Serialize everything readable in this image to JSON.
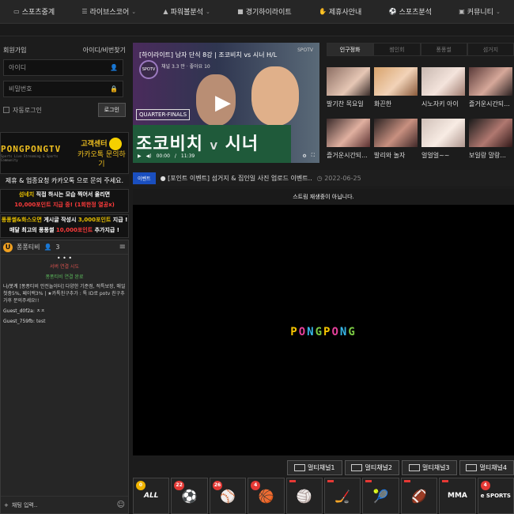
{
  "nav": [
    {
      "label": "스포츠중계",
      "icon": "tv-icon",
      "caret": false
    },
    {
      "label": "라이브스코어",
      "icon": "list-icon",
      "caret": true
    },
    {
      "label": "파워볼분석",
      "icon": "chart-icon",
      "caret": true
    },
    {
      "label": "경기하이라이트",
      "icon": "video-icon",
      "caret": false
    },
    {
      "label": "제휴사안내",
      "icon": "handshake-icon",
      "caret": false
    },
    {
      "label": "스포츠분석",
      "icon": "soccer-icon",
      "caret": false
    },
    {
      "label": "커뮤니티",
      "icon": "chat-icon",
      "caret": true
    }
  ],
  "login": {
    "join": "회원가입",
    "find": "아이디/비번찾기",
    "id_placeholder": "아이디",
    "pw_placeholder": "비밀번호",
    "auto": "자동로그인",
    "button": "로그인"
  },
  "banner": {
    "brand": "PONGPONGTV",
    "brand_sub": "Sports Live Streaming & Sports Community",
    "cs1": "고객센터",
    "cs2": "카카오톡 문의하기"
  },
  "notices": {
    "line1": "제휴 & 업종요청 카카오톡 으로 문의 주세요.",
    "n2_a": "섬네치",
    "n2_b": " 직접 하시는 모습 찍어서 올리면",
    "n2_c": "10,000포인트 지급 중! (1회한정 열공x)",
    "n3_a": "퐁퐁썰&화스오면",
    "n3_b": " 게시글 작성시 ",
    "n3_c": "3,000포인트",
    "n3_d": " 지급 !",
    "n3_e": "매달 최고의 퐁퐁썰 ",
    "n3_f": "10,000포인트",
    "n3_g": " 추가지급 !"
  },
  "chat": {
    "room": "퐁퐁티비",
    "users": "3",
    "sys1": "서버 연결 시도",
    "sys2": "퐁퐁티비 연결 완료",
    "messages": [
      {
        "name": "나/봇계",
        "text": "[퐁퐁티비 안전놀이터] 다양한 기준점, 적특보장, 매일첫충5%, 페이백3% | ★카톡친구추가 : 톡 ID로 potv 친구추가후 문의주세요!!"
      },
      {
        "name": "Guest_d0f2a:",
        "text": "ㅈㅈ"
      },
      {
        "name": "Guest_759fb:",
        "text": "test"
      }
    ],
    "input_placeholder": "채팅 입력.."
  },
  "hero": {
    "title": "[하이라이트] 남자 단식 8강 | 조코비치 vs 시너 H/L",
    "meta": "채널 3.3 만 · 좋아요 10",
    "badge": "SPOTV",
    "corner": "SPOTV",
    "stage": "QUARTER-FINALS",
    "big_left": "조코비치",
    "big_v": "V",
    "big_right": "시너",
    "time_now": "00:00",
    "time_total": "11:39"
  },
  "tabs": [
    "인구정화",
    "썸인회",
    "퐁퐁썰",
    "섬거지"
  ],
  "thumbs": [
    {
      "caption": "발기찬 목요일"
    },
    {
      "caption": "화끈한"
    },
    {
      "caption": "시노자키 아이"
    },
    {
      "caption": "즐거운시간되..."
    },
    {
      "caption": "즐거운시간되..."
    },
    {
      "caption": "발리와 놀자"
    },
    {
      "caption": "얼얼얼~~"
    },
    {
      "caption": "보일랑 말랑..."
    }
  ],
  "ticker": {
    "tag": "이벤트",
    "text": "● [포인트 이벤트] 섬거지 & 집인일 사진 업로드 이벤트..",
    "date": "2022-06-25"
  },
  "player": {
    "message": "스트림 재생중이 아닙니다.",
    "logo": [
      "P",
      "O",
      "N",
      "G",
      "P",
      "O",
      "N",
      "G"
    ]
  },
  "multi": [
    "멀티채널1",
    "멀티채널2",
    "멀티채널3",
    "멀티채널4"
  ],
  "sports": [
    {
      "name": "all-icon",
      "glyph": "ALL",
      "badge": "0",
      "gold": true
    },
    {
      "name": "soccer-icon",
      "glyph": "⚽",
      "badge": "22",
      "gold": false
    },
    {
      "name": "baseball-icon",
      "glyph": "⚾",
      "badge": "26",
      "gold": false
    },
    {
      "name": "basketball-icon",
      "glyph": "🏀",
      "badge": "4",
      "gold": false
    },
    {
      "name": "volleyball-icon",
      "glyph": "🏐",
      "badge": "",
      "gold": false
    },
    {
      "name": "hockey-icon",
      "glyph": "🏒",
      "badge": "",
      "gold": false
    },
    {
      "name": "tennis-icon",
      "glyph": "🎾",
      "badge": "",
      "gold": false
    },
    {
      "name": "football-icon",
      "glyph": "🏈",
      "badge": "",
      "gold": false
    },
    {
      "name": "mma-icon",
      "glyph": "MMA",
      "badge": "",
      "gold": false
    },
    {
      "name": "esports-icon",
      "glyph": "e SPORTS",
      "badge": "4",
      "gold": false
    }
  ]
}
